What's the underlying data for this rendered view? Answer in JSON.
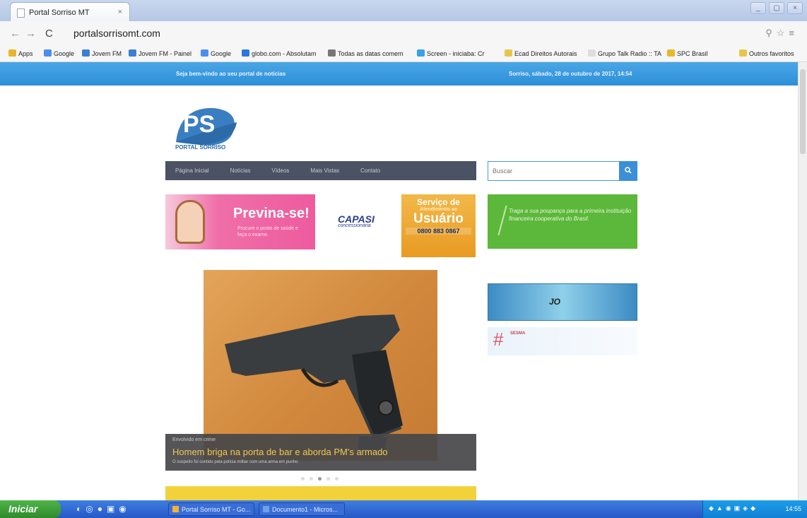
{
  "browser": {
    "tab_title": "Portal Sorriso MT",
    "tab_close": "×",
    "url": "portalsorrisomt.com",
    "window_buttons": [
      "_",
      "▢",
      "×"
    ],
    "bookmarks": [
      "Apps",
      "Google",
      "Jovem FM",
      "Jovem FM - Painel",
      "Google",
      "globo.com - Absolutam",
      "Todas as datas comem",
      "Screen - iniciaba: Cr",
      "Ecad Direitos Autorais",
      "Grupo Talk Radio :: TA",
      "SPC Brasil",
      "Outros favoritos"
    ]
  },
  "site": {
    "topbar_left": "Seja bem-vindo ao seu portal de notícias",
    "topbar_right": "Sorriso, sábado, 28 de outubro de 2017, 14:54",
    "logo_letters": "PS",
    "logo_caption": "PORTAL SORRISO",
    "menu": [
      "Página Inicial",
      "Notícias",
      "Vídeos",
      "Mais Vistas",
      "Contato"
    ],
    "search_placeholder": "Buscar",
    "search_icon": "search-icon",
    "banners": {
      "previna_title": "Previna-se!",
      "previna_sub": "Procure o posto de saúde e faça o exame.",
      "capasi": "CAPASI",
      "capasi_sub": "concessionária",
      "usuario_1": "Serviço de",
      "usuario_2": "Atendimento ao",
      "usuario_3": "Usuário",
      "usuario_phone": "0800 883 0867",
      "green_text": "Traga a sua poupança para a primeira instituição financeira cooperativa do Brasil.",
      "blue_text": "JO",
      "hash_text": "SESMA"
    },
    "slider": {
      "category": "Envolvido em crime",
      "headline": "Homem briga na porta de bar e aborda PM's armado",
      "subline": "O suspeito foi contido pela polícia militar com uma arma em punho"
    }
  },
  "taskbar": {
    "start": "Iniciar",
    "tasks": [
      "Portal Sorriso MT - Go...",
      "Documento1 - Micros..."
    ],
    "clock": "14:55"
  }
}
